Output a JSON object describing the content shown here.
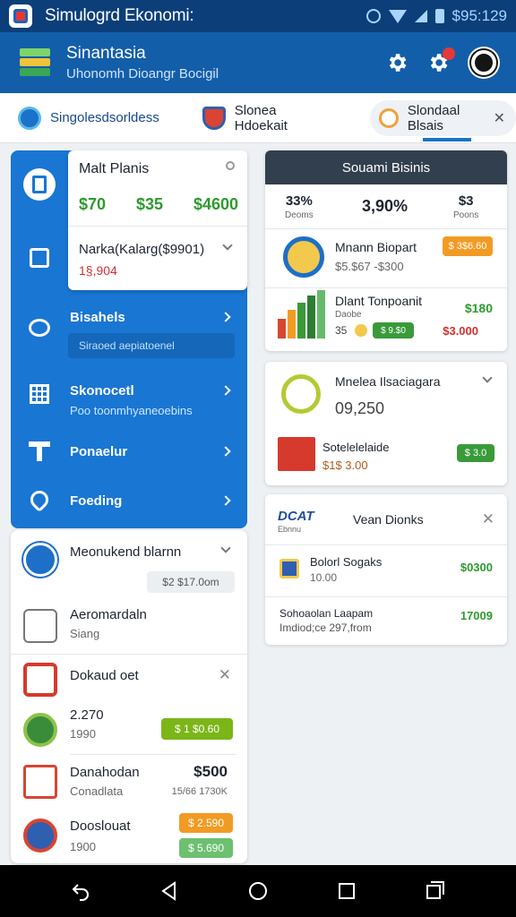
{
  "status_bar": {
    "app_title": "Simulogrd Ekonomi:",
    "clock_text": "$95:129"
  },
  "app_bar": {
    "title": "Sinantasia",
    "subtitle": "Uhonomh Dioangr Bocigil"
  },
  "tabs": [
    {
      "label": "Singolesdsorldess"
    },
    {
      "label": "Slonea Hdoekait"
    },
    {
      "label": "Slondaal Blsais",
      "close": "✕"
    }
  ],
  "left_panel": {
    "plans_card": {
      "title": "Malt Planis",
      "values": [
        "$70",
        "$35",
        "$4600"
      ],
      "sub_title": "Narka(Kalarg($9901)",
      "sub_value": "1§,904"
    },
    "items": [
      {
        "title": "Bisahels",
        "sub": "Siraoed aepiatoenel"
      },
      {
        "title": "Skonocetl",
        "sub": "Poo toonmhyaneoebins"
      },
      {
        "title": "Ponaelur",
        "sub": ""
      },
      {
        "title": "Foeding",
        "sub": ""
      }
    ]
  },
  "left_card": {
    "rows": [
      {
        "title": "Meonukend blarnn",
        "pill": "$2 $17.0om"
      },
      {
        "title": "Aeromardaln",
        "sub": "Siang"
      },
      {
        "title": "Dokaud oet",
        "close": "✕"
      },
      {
        "title": "2.270",
        "sub": "1990",
        "pill": "$ 1 $0.60"
      },
      {
        "title": "Danahodan",
        "sub": "Conadlata",
        "value": "$500",
        "value_sub": "15/66 1730K"
      },
      {
        "title": "Dooslouat",
        "sub": "1900",
        "pill_a": "$ 2.590",
        "pill_b": "$ 5.690"
      }
    ]
  },
  "card1": {
    "header": "Souami Bisinis",
    "stats": [
      {
        "value": "33%",
        "label": "Deoms"
      },
      {
        "value": "3,90%",
        "label": ""
      },
      {
        "value": "$3",
        "label": "Poons"
      }
    ],
    "rows": [
      {
        "title": "Mnann Biopart",
        "sub": "$5.$67 -$300",
        "badge": "$ 3$6.60"
      },
      {
        "title": "Dlant Tonpoanit",
        "sub": "Daobe",
        "value": "$180",
        "qty": "35",
        "pill": "$ 9.$0",
        "value2": "$3.000"
      }
    ]
  },
  "card2": {
    "title": "Mnelea Ilsaciagara",
    "number": "09,250",
    "row": {
      "title": "Sotelelelaide",
      "value": "$1$ 3.00",
      "pill": "$ 3.0"
    }
  },
  "card3": {
    "logo": "DCAT",
    "logo_sub": "Ebnnu",
    "title": "Vean Dionks",
    "close": "✕",
    "rows": [
      {
        "title": "Bolorl Sogaks",
        "sub": "10.00",
        "value": "$0300"
      },
      {
        "title": "Sohoaolan Laapam",
        "sub": "Imdiod;ce 297,from",
        "value": "17009"
      }
    ]
  },
  "colors": {
    "primary": "#1976d2",
    "appbar": "#135ea9",
    "statusbar": "#0c3f79",
    "green": "#2e9a2e",
    "red": "#d32f2f",
    "orange": "#f29b24"
  }
}
